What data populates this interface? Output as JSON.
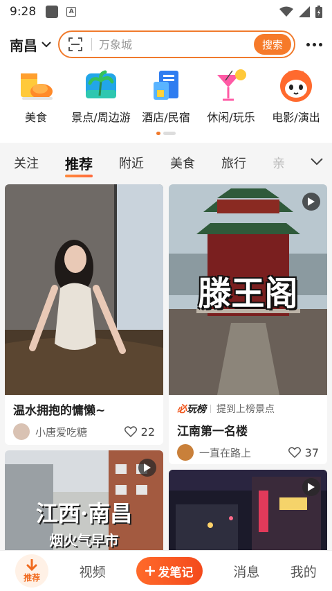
{
  "status_bar": {
    "time": "9:28"
  },
  "header": {
    "city": "南昌",
    "search_placeholder": "万象城",
    "search_button": "搜索"
  },
  "categories": [
    {
      "label": "美食",
      "icon": "food-icon"
    },
    {
      "label": "景点/周边游",
      "icon": "scenic-icon"
    },
    {
      "label": "酒店/民宿",
      "icon": "hotel-icon"
    },
    {
      "label": "休闲/玩乐",
      "icon": "leisure-icon"
    },
    {
      "label": "电影/演出",
      "icon": "movie-icon"
    }
  ],
  "tabs": [
    "关注",
    "推荐",
    "附近",
    "美食",
    "旅行",
    "亲"
  ],
  "active_tab": "推荐",
  "cards": [
    {
      "title": "温水拥抱的慵懒~",
      "author": "小唐爱吃糖",
      "likes": "22"
    },
    {
      "rank_logo_prefix": "必",
      "rank_logo": "玩榜",
      "rank_text": "提到上榜景点",
      "overlay_text": "滕王阁",
      "title": "江南第一名楼",
      "author": "一直在路上",
      "likes": "37"
    },
    {
      "overlay_title": "江西·南昌",
      "overlay_sub": "烟火气早市"
    },
    {}
  ],
  "bottom_nav": {
    "home": "推荐",
    "video": "视频",
    "post": "发笔记",
    "messages": "消息",
    "me": "我的"
  },
  "colors": {
    "accent": "#f67a2a",
    "post_button": "#f44a1c"
  }
}
